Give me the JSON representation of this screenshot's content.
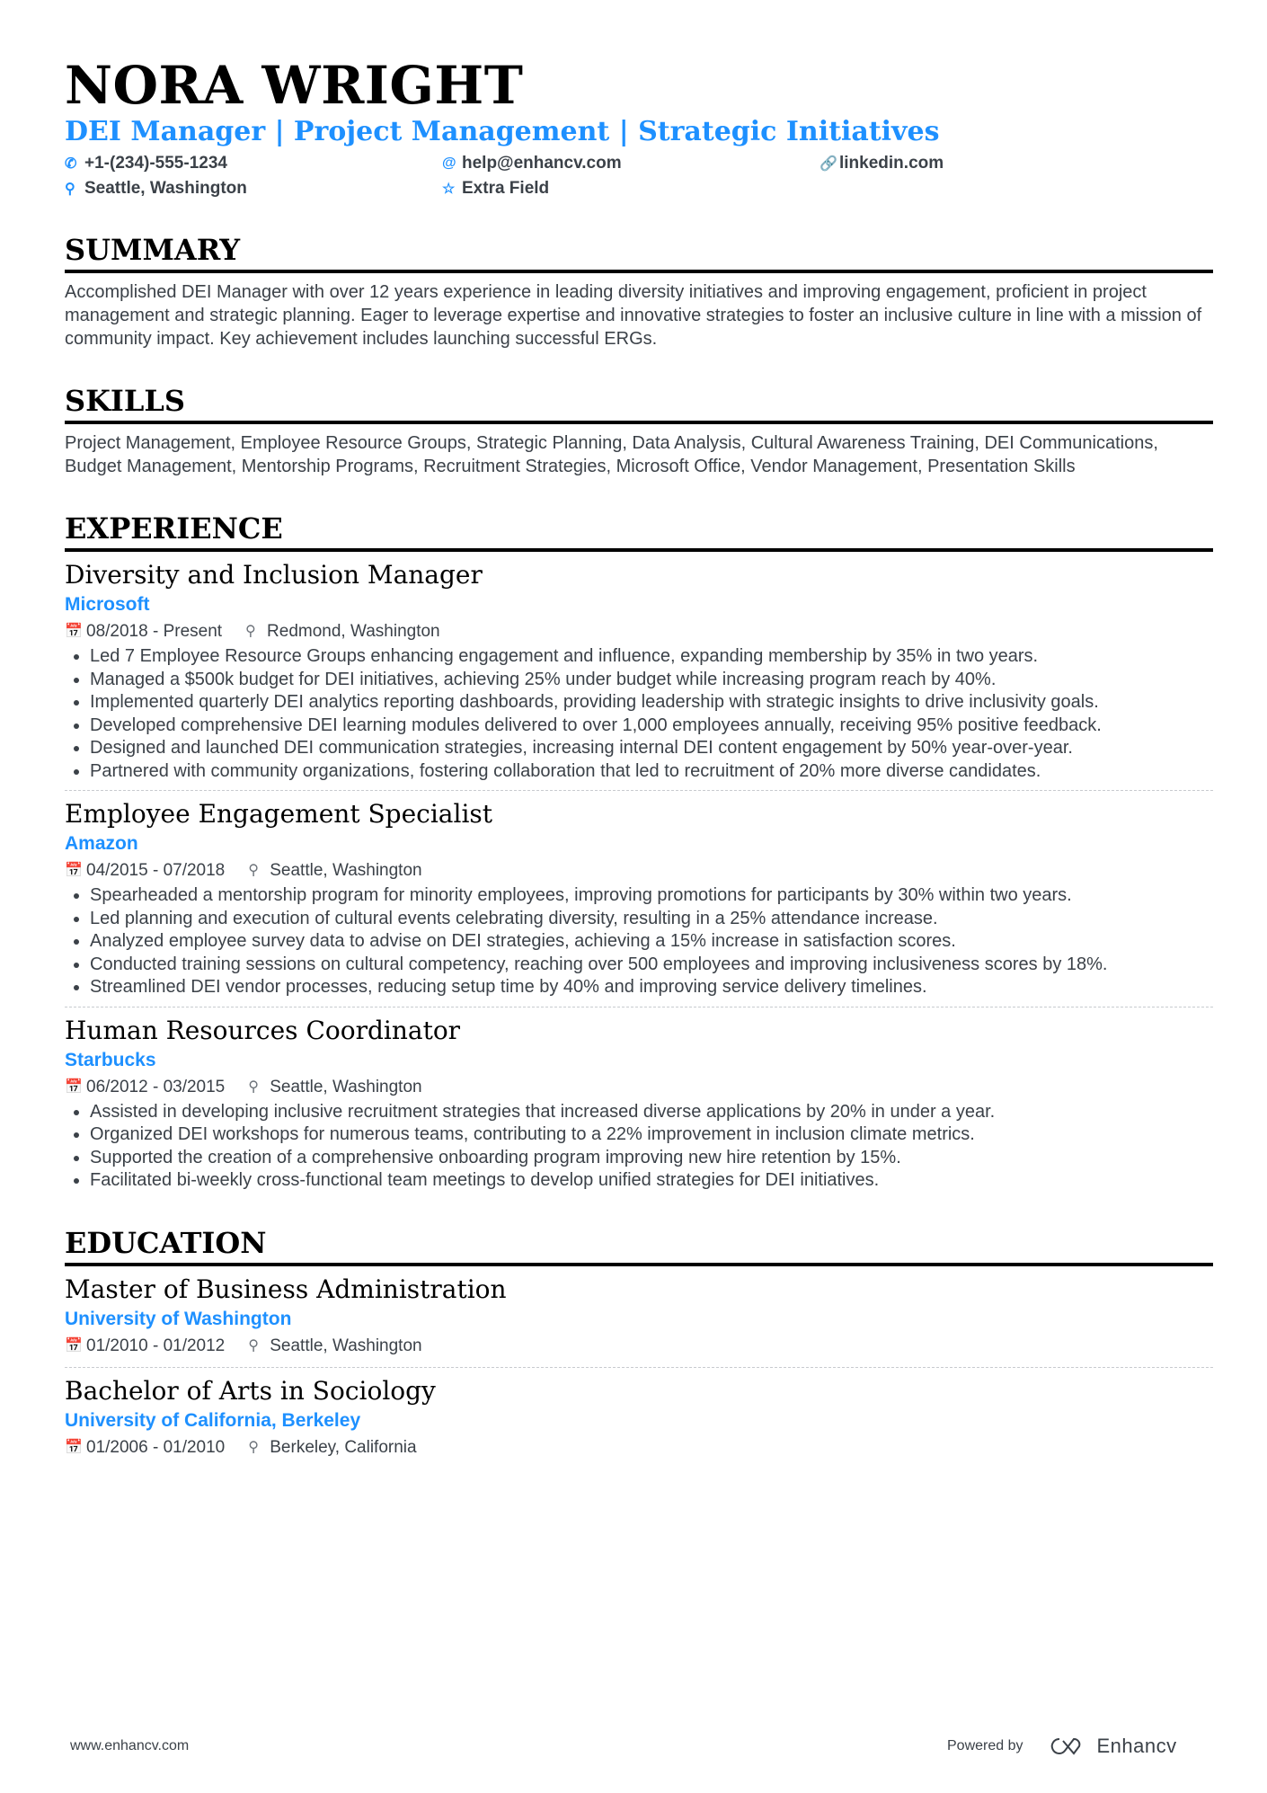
{
  "header": {
    "name": "NORA WRIGHT",
    "title": "DEI Manager | Project Management | Strategic Initiatives",
    "contacts": [
      {
        "icon": "phone-icon",
        "text": "+1-(234)-555-1234"
      },
      {
        "icon": "at-icon",
        "text": "help@enhancv.com"
      },
      {
        "icon": "link-icon",
        "text": "linkedin.com"
      },
      {
        "icon": "location-pin-icon",
        "text": "Seattle, Washington"
      },
      {
        "icon": "star-icon",
        "text": "Extra Field"
      }
    ]
  },
  "summary": {
    "heading": "SUMMARY",
    "text": "Accomplished DEI Manager with over 12 years experience in leading diversity initiatives and improving engagement, proficient in project management and strategic planning. Eager to leverage expertise and innovative strategies to foster an inclusive culture in line with a mission of community impact. Key achievement includes launching successful ERGs."
  },
  "skills": {
    "heading": "SKILLS",
    "text": "Project Management, Employee Resource Groups, Strategic Planning, Data Analysis, Cultural Awareness Training, DEI Communications, Budget Management, Mentorship Programs, Recruitment Strategies, Microsoft Office, Vendor Management, Presentation Skills"
  },
  "experience": {
    "heading": "EXPERIENCE",
    "items": [
      {
        "title": "Diversity and Inclusion Manager",
        "company": "Microsoft",
        "dates": "08/2018 - Present",
        "location": "Redmond, Washington",
        "bullets": [
          "Led 7 Employee Resource Groups enhancing engagement and influence, expanding membership by 35% in two years.",
          "Managed a $500k budget for DEI initiatives, achieving 25% under budget while increasing program reach by 40%.",
          "Implemented quarterly DEI analytics reporting dashboards, providing leadership with strategic insights to drive inclusivity goals.",
          "Developed comprehensive DEI learning modules delivered to over 1,000 employees annually, receiving 95% positive feedback.",
          "Designed and launched DEI communication strategies, increasing internal DEI content engagement by 50% year-over-year.",
          "Partnered with community organizations, fostering collaboration that led to recruitment of 20% more diverse candidates."
        ]
      },
      {
        "title": "Employee Engagement Specialist",
        "company": "Amazon",
        "dates": "04/2015 - 07/2018",
        "location": "Seattle, Washington",
        "bullets": [
          "Spearheaded a mentorship program for minority employees, improving promotions for participants by 30% within two years.",
          "Led planning and execution of cultural events celebrating diversity, resulting in a 25% attendance increase.",
          "Analyzed employee survey data to advise on DEI strategies, achieving a 15% increase in satisfaction scores.",
          "Conducted training sessions on cultural competency, reaching over 500 employees and improving inclusiveness scores by 18%.",
          "Streamlined DEI vendor processes, reducing setup time by 40% and improving service delivery timelines."
        ]
      },
      {
        "title": "Human Resources Coordinator",
        "company": "Starbucks",
        "dates": "06/2012 - 03/2015",
        "location": "Seattle, Washington",
        "bullets": [
          "Assisted in developing inclusive recruitment strategies that increased diverse applications by 20% in under a year.",
          "Organized DEI workshops for numerous teams, contributing to a 22% improvement in inclusion climate metrics.",
          "Supported the creation of a comprehensive onboarding program improving new hire retention by 15%.",
          "Facilitated bi-weekly cross-functional team meetings to develop unified strategies for DEI initiatives."
        ]
      }
    ]
  },
  "education": {
    "heading": "EDUCATION",
    "items": [
      {
        "degree": "Master of Business Administration",
        "school": "University of Washington",
        "dates": "01/2010 - 01/2012",
        "location": "Seattle, Washington"
      },
      {
        "degree": "Bachelor of Arts in Sociology",
        "school": "University of California, Berkeley",
        "dates": "01/2006 - 01/2010",
        "location": "Berkeley, California"
      }
    ]
  },
  "footer": {
    "website": "www.enhancv.com",
    "powered_by": "Powered by",
    "brand": "Enhancv"
  }
}
